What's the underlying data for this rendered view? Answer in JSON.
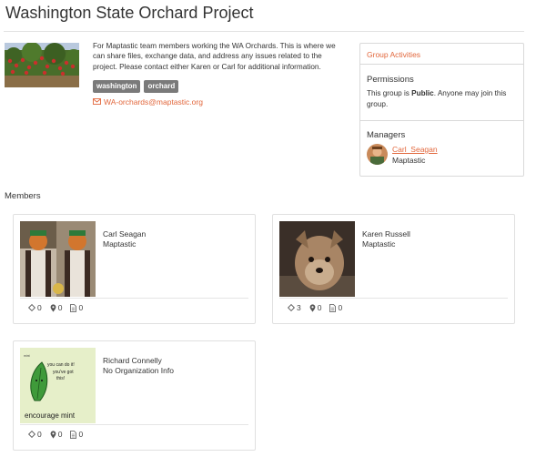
{
  "page": {
    "title": "Washington State Orchard Project"
  },
  "group": {
    "description": "For Maptastic team members working the WA Orchards. This is where we can share files, exchange data, and address any issues related to the project. Please contact either Karen or Carl for additional information.",
    "tags": [
      "washington",
      "orchard"
    ],
    "email": "WA-orchards@maptastic.org"
  },
  "sidebar": {
    "group_activities": "Group Activities",
    "permissions": {
      "title": "Permissions",
      "text_before": "This group is ",
      "text_bold": "Public",
      "text_after": ". Anyone may join this group."
    },
    "managers": {
      "title": "Managers",
      "name": "Carl_Seagan",
      "org": "Maptastic"
    }
  },
  "members_label": "Members",
  "members": [
    {
      "name": "Carl Seagan",
      "org": "Maptastic",
      "stats": [
        "0",
        "0",
        "0"
      ]
    },
    {
      "name": "Karen Russell",
      "org": "Maptastic",
      "stats": [
        "3",
        "0",
        "0"
      ]
    },
    {
      "name": "Richard Connelly",
      "org": "No Organization Info",
      "stats": [
        "0",
        "0",
        "0"
      ],
      "photo_text": {
        "top_small": "mint",
        "bubble": "you can do it! you've got this!",
        "caption": "encourage mint"
      }
    }
  ],
  "colors": {
    "accent": "#e2673c",
    "tag": "#7a7a7a",
    "border": "#d9d9d9"
  },
  "icons": {
    "stat_icons": [
      "diamond-icon",
      "map-pin-icon",
      "document-icon"
    ],
    "email": "envelope-icon"
  }
}
